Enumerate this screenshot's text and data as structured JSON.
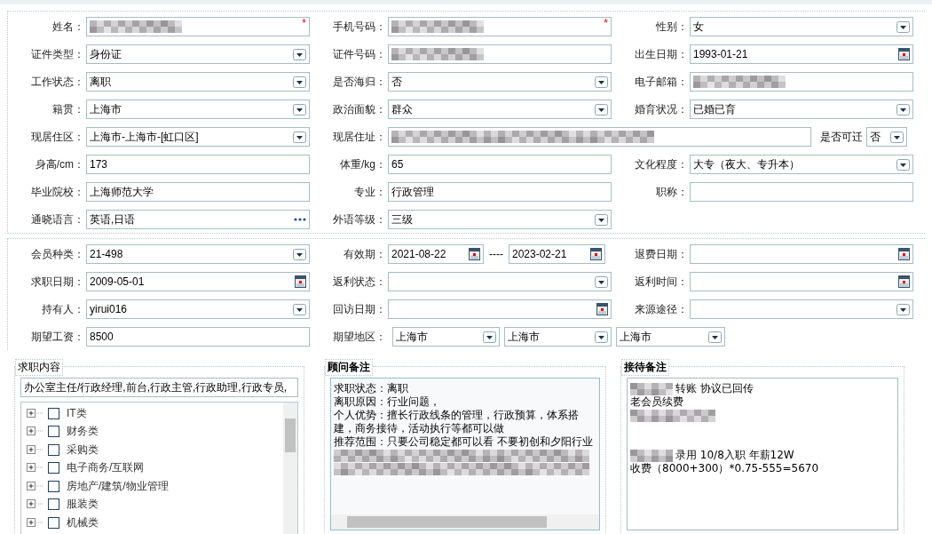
{
  "profile": {
    "rows": [
      [
        {
          "label": "姓名：",
          "kind": "text",
          "redacted": true,
          "required_mark": "*"
        },
        {
          "label": "手机号码：",
          "kind": "text",
          "redacted": true,
          "required_mark": "*"
        },
        {
          "label": "性别：",
          "kind": "select",
          "value": "女"
        }
      ],
      [
        {
          "label": "证件类型：",
          "kind": "select",
          "value": "身份证"
        },
        {
          "label": "证件号码：",
          "kind": "text",
          "redacted": true
        },
        {
          "label": "出生日期：",
          "kind": "date",
          "value": "1993-01-21"
        }
      ],
      [
        {
          "label": "工作状态：",
          "kind": "select",
          "value": "离职"
        },
        {
          "label": "是否海归：",
          "kind": "select",
          "value": "否"
        },
        {
          "label": "电子邮箱：",
          "kind": "text",
          "redacted": true
        }
      ],
      [
        {
          "label": "籍贯：",
          "kind": "select",
          "value": "上海市"
        },
        {
          "label": "政治面貌：",
          "kind": "select",
          "value": "群众"
        },
        {
          "label": "婚育状况：",
          "kind": "select",
          "value": "已婚已育"
        }
      ],
      [
        {
          "label": "现居住区：",
          "kind": "select",
          "value": " 上海市-上海市-[虹口区]"
        },
        {
          "label": "现居住址：",
          "kind": "address",
          "redacted": true,
          "extra_label": "是否可迁",
          "extra_value": "否"
        }
      ],
      [
        {
          "label": "身高/cm：",
          "kind": "text",
          "value": "173"
        },
        {
          "label": "体重/kg：",
          "kind": "text",
          "value": "65"
        },
        {
          "label": "文化程度：",
          "kind": "select",
          "value": "大专（夜大、专升本）"
        }
      ],
      [
        {
          "label": "毕业院校：",
          "kind": "text",
          "value": "上海师范大学"
        },
        {
          "label": "专业：",
          "kind": "text",
          "value": "行政管理"
        },
        {
          "label": "职称：",
          "kind": "text"
        }
      ],
      [
        {
          "label": "通晓语言：",
          "kind": "lookup",
          "value": "英语,日语"
        },
        {
          "label": "外语等级：",
          "kind": "select",
          "value": "三级"
        }
      ]
    ]
  },
  "membership": {
    "rows": [
      [
        {
          "label": "会员种类：",
          "kind": "select",
          "value": " 21-498"
        },
        {
          "label": "有效期：",
          "kind": "range",
          "value": "2021-08-22",
          "separator": "----",
          "end_value": "2023-02-21"
        },
        {
          "label": "退费日期：",
          "kind": "date"
        }
      ],
      [
        {
          "label": "求职日期：",
          "kind": "date",
          "value": "2009-05-01"
        },
        {
          "label": "返利状态：",
          "kind": "select"
        },
        {
          "label": "返利时间：",
          "kind": "date"
        }
      ],
      [
        {
          "label": "持有人：",
          "kind": "select",
          "value": "yirui016"
        },
        {
          "label": "回访日期：",
          "kind": "date"
        },
        {
          "label": "来源途径：",
          "kind": "select"
        }
      ],
      [
        {
          "label": "期望工资：",
          "kind": "text",
          "value": "8500"
        },
        {
          "label": "期望地区：",
          "kind": "multi",
          "values": [
            "上海市",
            "上海市",
            "上海市"
          ]
        }
      ]
    ]
  },
  "job_content": {
    "legend": "求职内容",
    "value": "办公室主任/行政经理,前台,行政主管,行政助理,行政专员,",
    "tree": [
      {
        "label": "IT类",
        "checked": false,
        "expanded": false
      },
      {
        "label": "财务类",
        "checked": false,
        "expanded": false
      },
      {
        "label": "采购类",
        "checked": false,
        "expanded": false
      },
      {
        "label": "电子商务/互联网",
        "checked": false,
        "expanded": false
      },
      {
        "label": "房地产/建筑/物业管理",
        "checked": false,
        "expanded": false
      },
      {
        "label": "服装类",
        "checked": false,
        "expanded": false
      },
      {
        "label": "机械类",
        "checked": false,
        "expanded": false
      }
    ]
  },
  "consultant_notes": {
    "legend": "顾问备注",
    "lines": [
      {
        "kind": "text",
        "text": "求职状态：离职"
      },
      {
        "kind": "text",
        "text": "离职原因：行业问题，"
      },
      {
        "kind": "text",
        "text": "个人优势：擅长行政线条的管理，行政预算，体系搭"
      },
      {
        "kind": "text",
        "text": "建，商务接待，活动执行等都可以做"
      },
      {
        "kind": "text",
        "text": "推荐范围：只要公司稳定都可以看 不要初创和夕阳行业"
      },
      {
        "kind": "redacted"
      },
      {
        "kind": "redacted"
      }
    ]
  },
  "reception_notes": {
    "legend": "接待备注",
    "lines": [
      {
        "kind": "text",
        "text": "转账 协议已回传",
        "redacted_prefix": true
      },
      {
        "kind": "text",
        "text": "老会员续费"
      },
      {
        "kind": "redacted"
      },
      {
        "kind": "blank"
      },
      {
        "kind": "blank"
      },
      {
        "kind": "text",
        "text": "录用 10/8入职 年薪12W",
        "redacted_prefix": true
      },
      {
        "kind": "text",
        "text": "收费（8000+300）*0.75-555=5670"
      }
    ]
  }
}
